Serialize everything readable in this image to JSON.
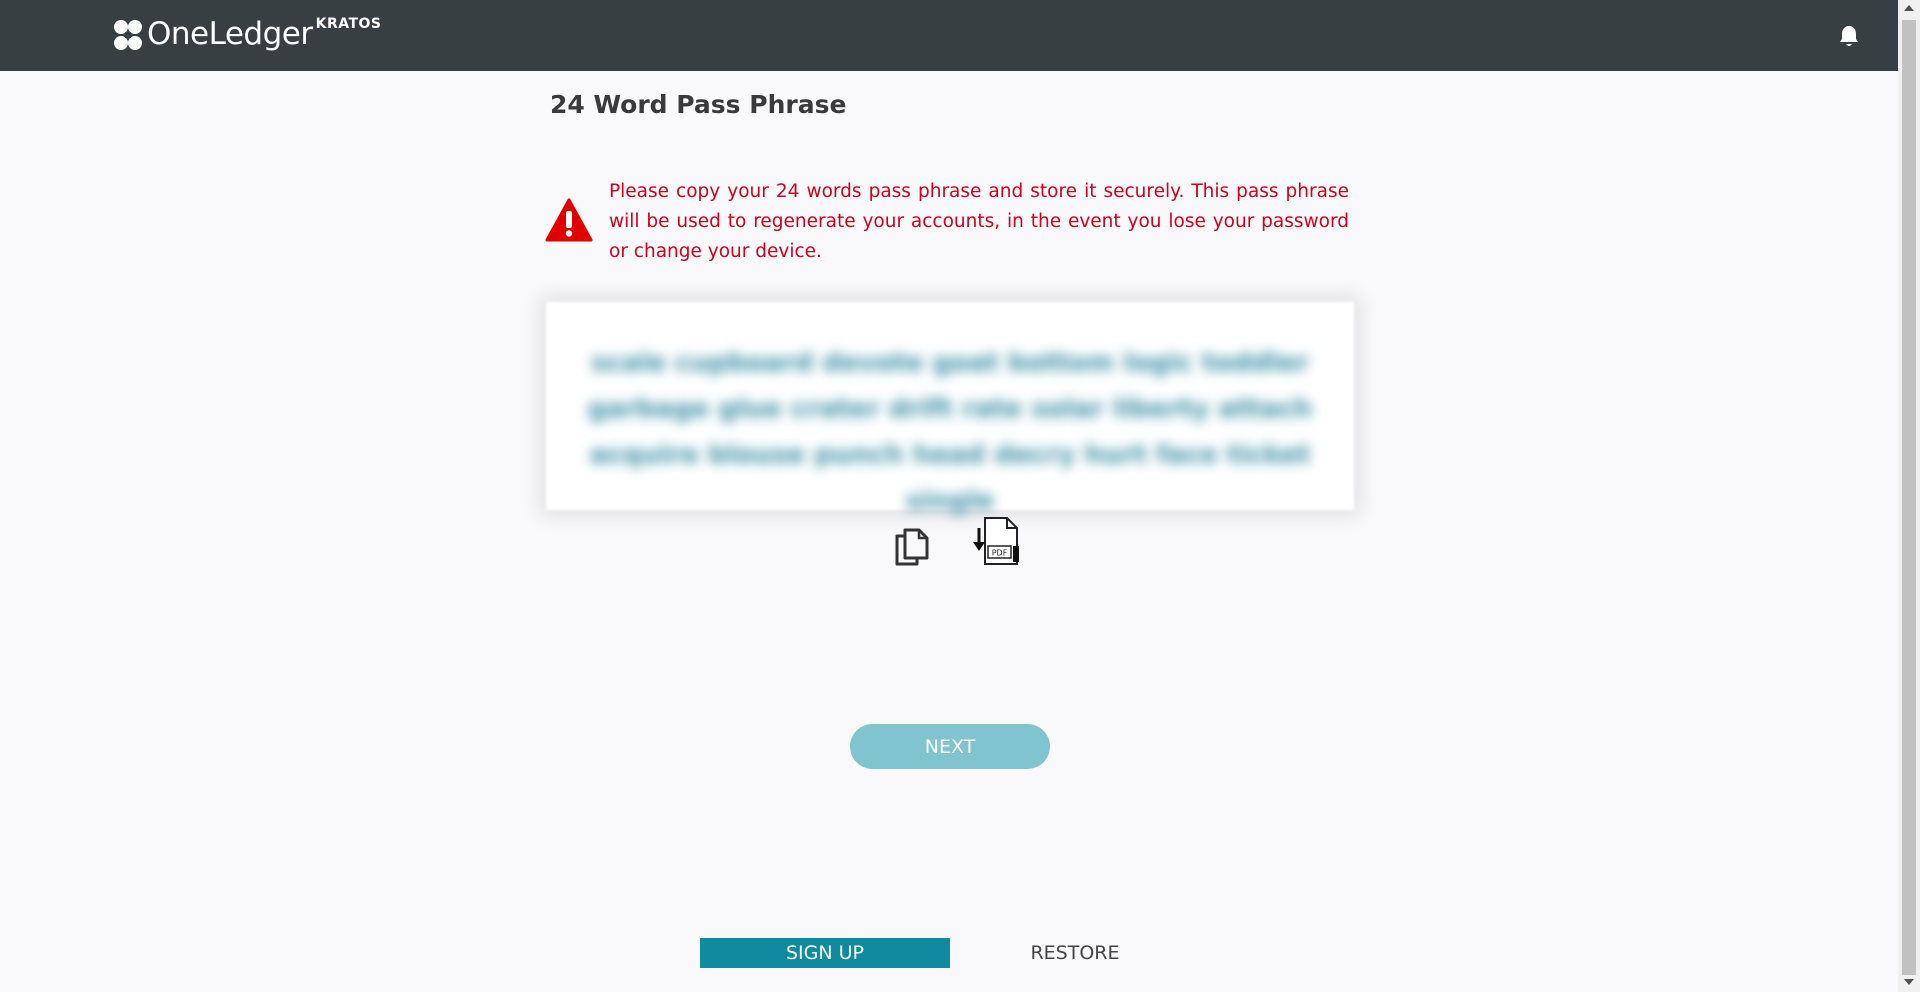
{
  "header": {
    "logo_text": "OneLedger",
    "logo_superscript": "KRATOS",
    "notification_icon": "bell-icon",
    "background_color": "#373f43"
  },
  "main": {
    "title": "24 Word Pass Phrase",
    "warning_icon": "warning-triangle-icon",
    "warning_text": "Please copy your 24 words pass phrase and store it securely. This pass phrase will be used to regenerate your accounts, in the event you lose your password or change your device.",
    "warning_color": "#d0021b",
    "pass_phrase_blurred": "scale cupboard devote goat bottom logic toddler garbage glue crater drift rate solar liberty attach acquire blouse punch head decry hurt face ticket single",
    "copy_icon": "copy-icon",
    "pdf_icon": "pdf-download-icon",
    "next_label": "NEXT",
    "next_color": "#7fc4ce"
  },
  "footer_tabs": {
    "signup_label": "SIGN UP",
    "restore_label": "RESTORE",
    "active_color": "#0f8a9e"
  }
}
